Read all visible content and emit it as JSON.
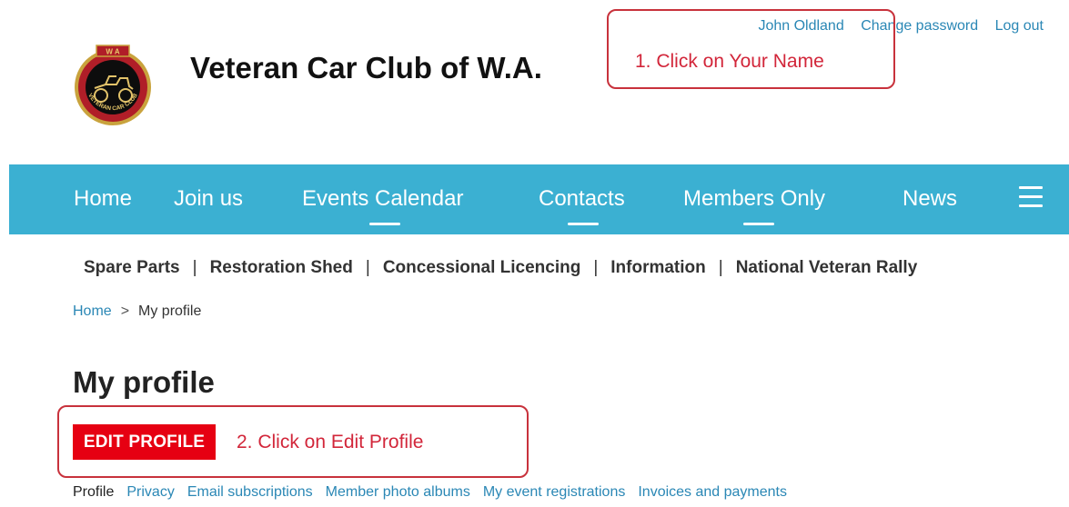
{
  "header": {
    "site_title": "Veteran Car Club of W.A.",
    "logo_top_letters": "W A",
    "logo_bottom_text": "VETERAN CAR CLUB",
    "user_links": [
      "John Oldland",
      "Change password",
      "Log out"
    ]
  },
  "annotations": {
    "step1": "1. Click on Your Name",
    "step2": "2. Click on Edit Profile",
    "color": "#d2263a"
  },
  "nav": {
    "background": "#3bb0d2",
    "items": [
      "Home",
      "Join us",
      "Events Calendar",
      "Contacts",
      "Members Only",
      "News"
    ],
    "menu_icon": "hamburger-icon"
  },
  "subnav": {
    "items": [
      "Spare Parts",
      "Restoration Shed",
      "Concessional Licencing",
      "Information",
      "National Veteran Rally"
    ],
    "separator": "|"
  },
  "breadcrumb": {
    "home": "Home",
    "separator": ">",
    "current": "My profile"
  },
  "page": {
    "title": "My profile",
    "edit_button": "EDIT PROFILE",
    "edit_button_color": "#e60012",
    "tabs": [
      "Profile",
      "Privacy",
      "Email subscriptions",
      "Member photo albums",
      "My event registrations",
      "Invoices and payments"
    ]
  }
}
